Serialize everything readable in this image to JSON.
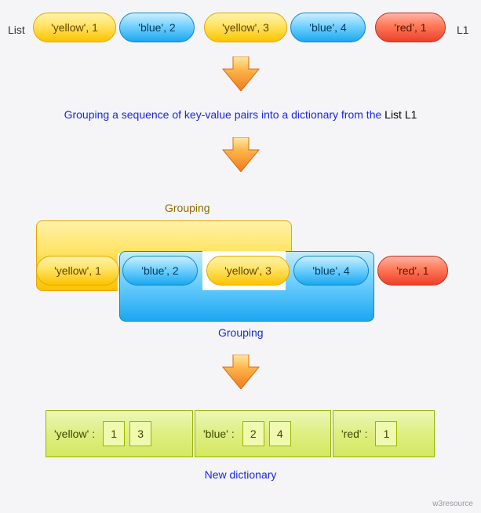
{
  "labels": {
    "list_left": "List",
    "list_right": "L1",
    "grouping_top": "Grouping",
    "grouping_bottom": "Grouping",
    "description_pre": "Grouping a sequence of key-value pairs into a dictionary from the ",
    "description_bold": "List L1",
    "new_dict": "New dictionary",
    "attribution": "w3resource"
  },
  "pills": [
    {
      "text": "'yellow', 1"
    },
    {
      "text": "'blue', 2"
    },
    {
      "text": "'yellow', 3"
    },
    {
      "text": "'blue', 4"
    },
    {
      "text": "'red', 1"
    }
  ],
  "dict": [
    {
      "key": "'yellow'",
      "values": [
        "1",
        "3"
      ]
    },
    {
      "key": "'blue'",
      "values": [
        "2",
        "4"
      ]
    },
    {
      "key": "'red'",
      "values": [
        "1"
      ]
    }
  ],
  "chart_data": {
    "type": "table",
    "title": "Grouping a sequence of key-value pairs into a dictionary",
    "input_list_name": "L1",
    "input_pairs": [
      {
        "key": "yellow",
        "value": 1
      },
      {
        "key": "blue",
        "value": 2
      },
      {
        "key": "yellow",
        "value": 3
      },
      {
        "key": "blue",
        "value": 4
      },
      {
        "key": "red",
        "value": 1
      }
    ],
    "output_dict": {
      "yellow": [
        1,
        3
      ],
      "blue": [
        2,
        4
      ],
      "red": [
        1
      ]
    }
  }
}
